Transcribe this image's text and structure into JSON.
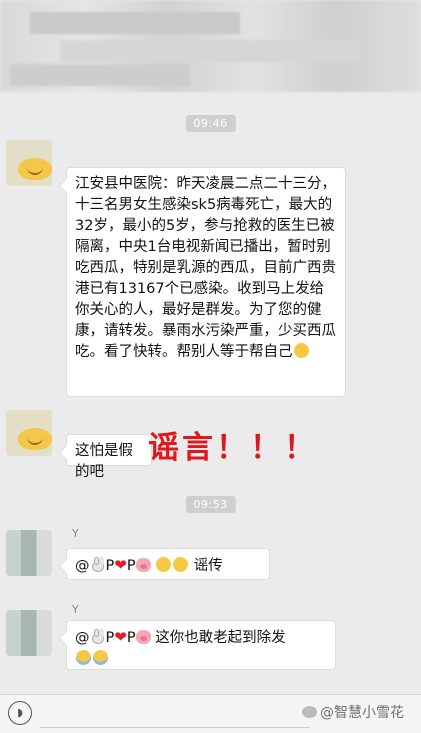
{
  "timestamps": [
    "09:46",
    "09:53"
  ],
  "messages": [
    {
      "text": "江安县中医院：昨天凌晨二点二十三分，十三名男女生感染sk5病毒死亡，最大的32岁，最小的5岁，参与抢救的医生已被隔离，中央1台电视新闻已播出，暂时别吃西瓜，特别是乳源的西瓜，目前广西贵港已有13167个已感染。收到马上发给你关心的人，最好是群发。为了您的健康，请转发。暴雨水污染严重，少买西瓜吃。看了快转。帮别人等于帮自己"
    },
    {
      "text": "这怕是假的吧"
    },
    {
      "sender": "Y",
      "prefix": "@",
      "p1": "P",
      "p2": "P",
      "text": "谣传"
    },
    {
      "sender": "Y",
      "prefix": "@",
      "p1": "P",
      "p2": "P",
      "text": "这你也敢老起到除发"
    }
  ],
  "stamp_text": "谣言！！！",
  "watermark": "@智慧小雪花",
  "icons": [
    "voice-icon",
    "smile-emoji",
    "bunny-emoji",
    "heart-emoji",
    "pig-emoji",
    "laugh-emoji",
    "cry-emoji"
  ],
  "colors": {
    "stamp": "#e0181e",
    "background": "#ebebeb"
  }
}
